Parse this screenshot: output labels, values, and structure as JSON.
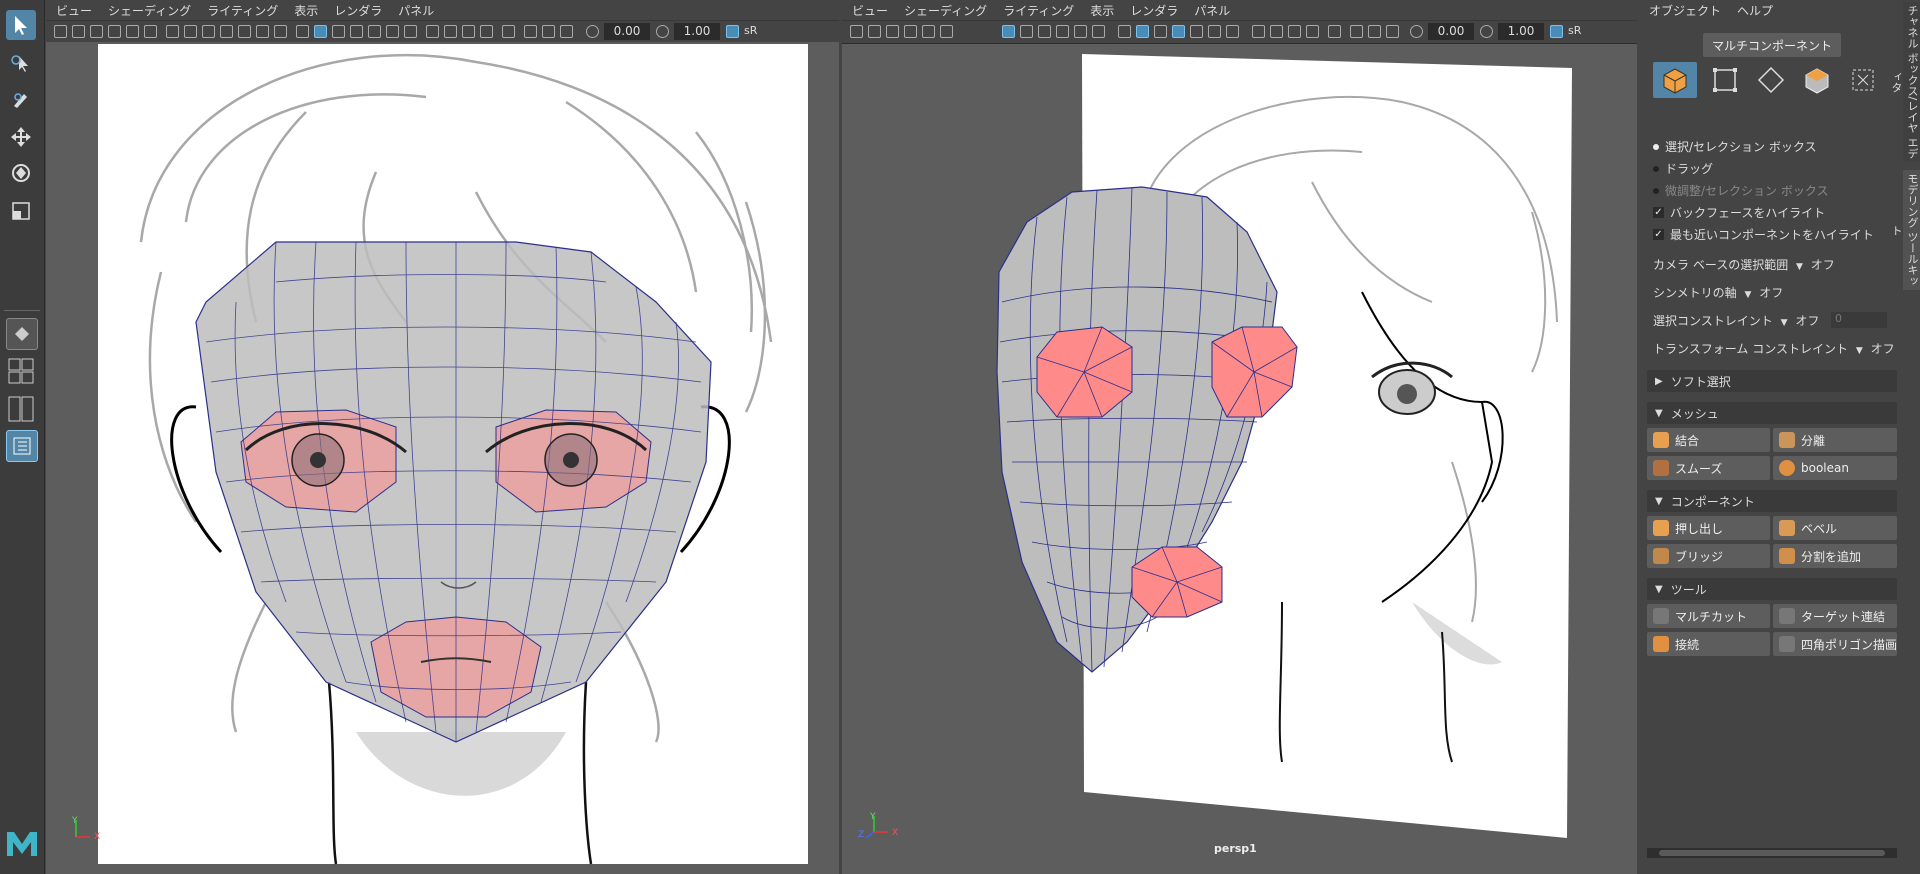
{
  "left_view": {
    "menu": [
      "ビュー",
      "シェーディング",
      "ライティング",
      "表示",
      "レンダラ",
      "パネル"
    ],
    "field1": "0.00",
    "field2": "1.00",
    "color_space": "sR"
  },
  "right_view": {
    "menu": [
      "ビュー",
      "シェーディング",
      "ライティング",
      "表示",
      "レンダラ",
      "パネル"
    ],
    "field1": "0.00",
    "field2": "1.00",
    "color_space": "sR",
    "camera_label": "persp1"
  },
  "axis_labels": {
    "y": "Y",
    "z": "Z",
    "x": "X"
  },
  "tool_panel": {
    "menu": [
      "オブジェクト",
      "ヘルプ"
    ],
    "mode_button": "マルチコンポーネント",
    "radio_options": [
      "選択/セレクション ボックス",
      "ドラッグ",
      "微調整/セレクション ボックス"
    ],
    "checkbox_options": [
      "バックフェースをハイライト",
      "最も近いコンポーネントをハイライト"
    ],
    "dropdowns": [
      {
        "label": "カメラ ベースの選択範囲",
        "value": "オフ"
      },
      {
        "label": "シンメトリの軸",
        "value": "オフ"
      },
      {
        "label": "選択コンストレイント",
        "value": "オフ",
        "extra": "0"
      },
      {
        "label": "トランスフォーム コンストレイント",
        "value": "オフ"
      }
    ],
    "soft_select": "ソフト選択",
    "sections": [
      {
        "title": "メッシュ",
        "buttons": [
          "結合",
          "分離",
          "スムーズ",
          "boolean"
        ]
      },
      {
        "title": "コンポーネント",
        "buttons": [
          "押し出し",
          "ベベル",
          "ブリッジ",
          "分割を追加"
        ]
      },
      {
        "title": "ツール",
        "buttons": [
          "マルチカット",
          "ターゲット連結",
          "接続",
          "四角ポリゴン描画"
        ]
      }
    ]
  },
  "side_tabs": [
    "チャネル ボックス/レイヤ エディタ",
    "モデリング ツールキット"
  ],
  "colors": {
    "accent": "#5285a6",
    "highlight_red": "#ff8a8a",
    "mesh_gray": "#bdbdbd",
    "wire_blue": "#2b2f8c"
  }
}
